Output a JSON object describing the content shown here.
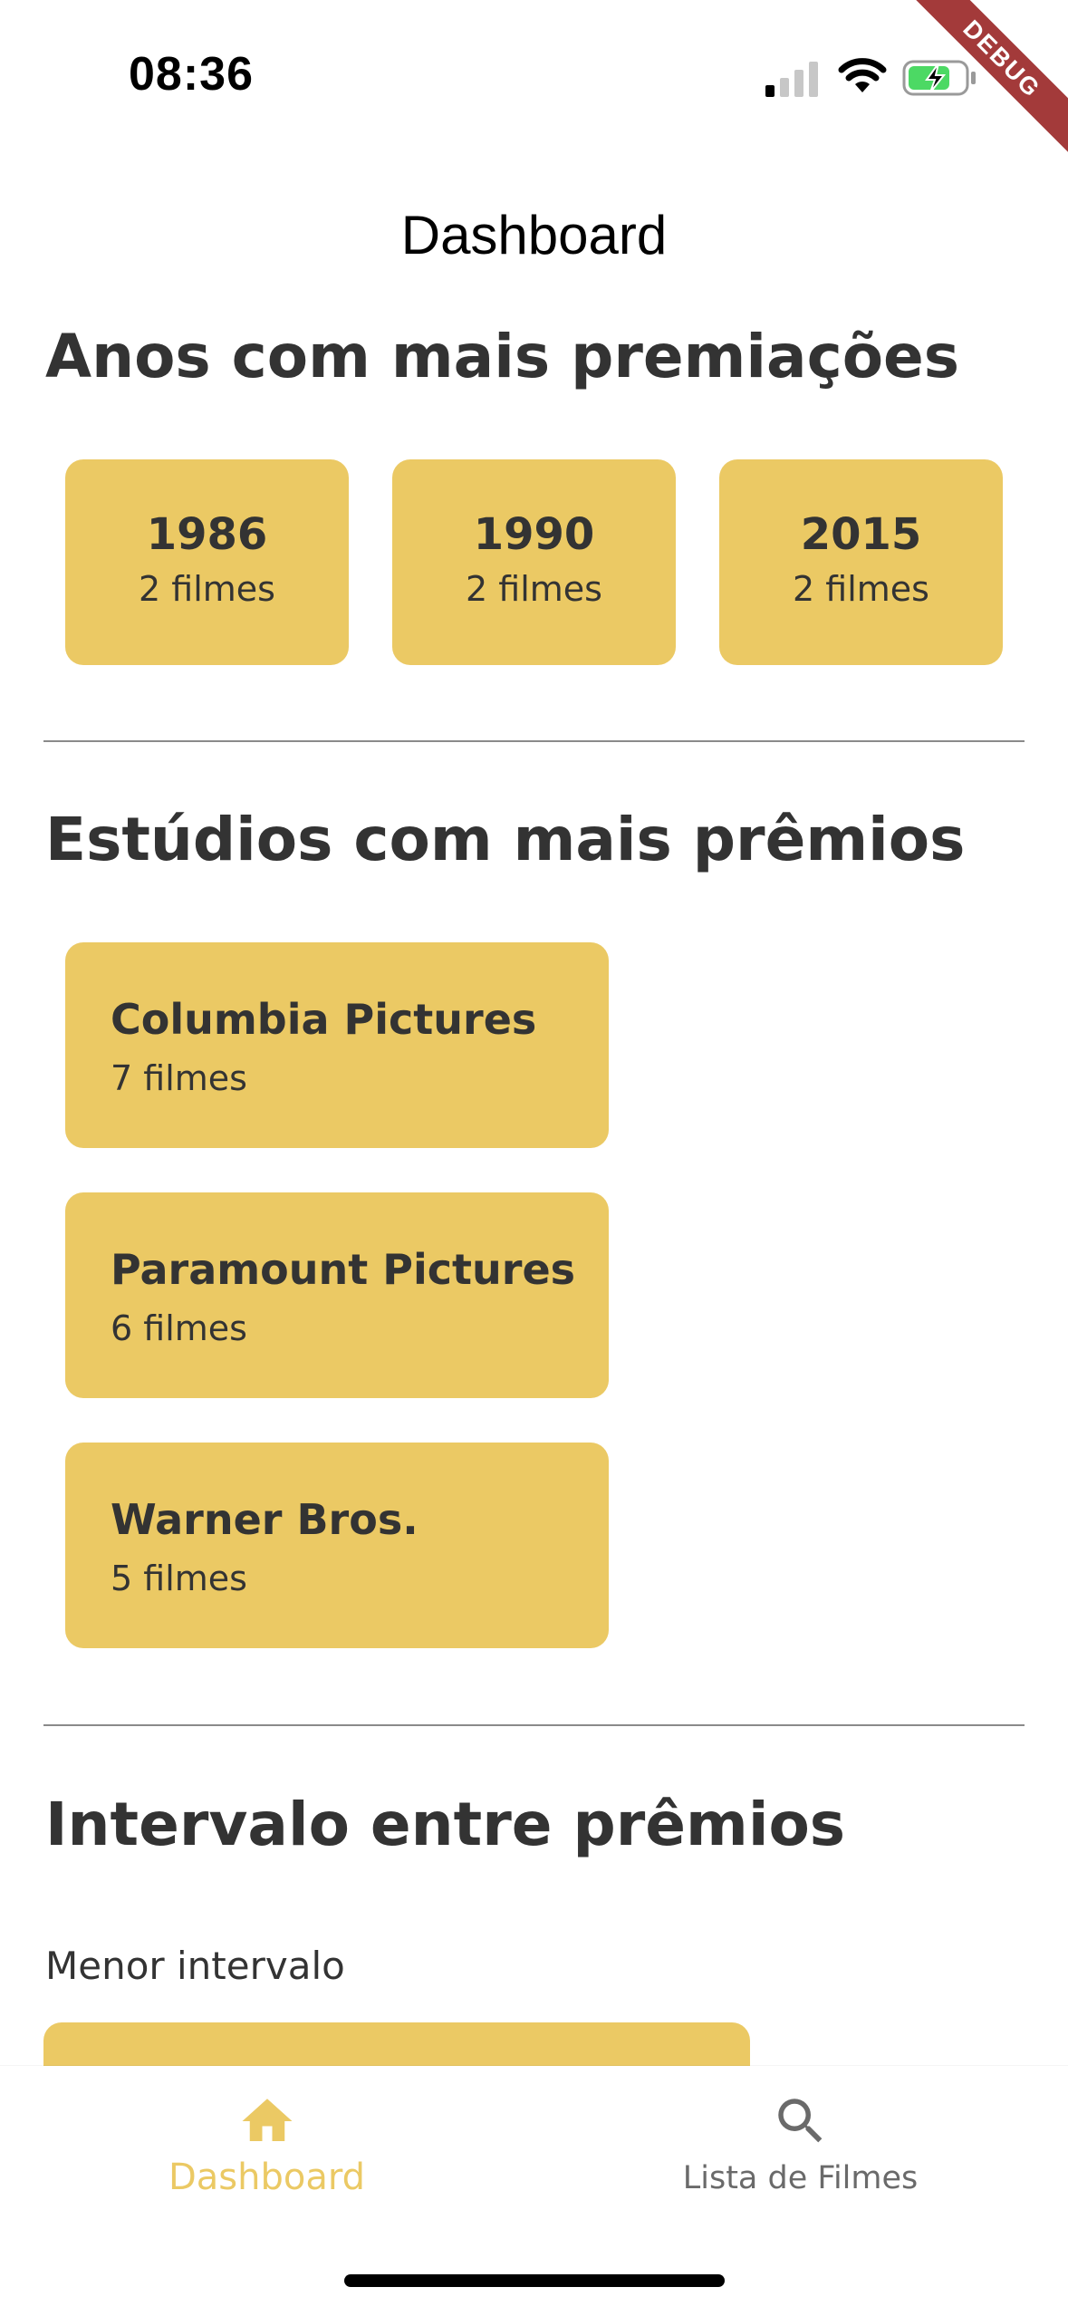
{
  "status_bar": {
    "time": "08:36",
    "signal_icon": "cellular-signal-icon",
    "wifi_icon": "wifi-icon",
    "battery_icon": "battery-charging-icon",
    "debug_banner": "DEBUG"
  },
  "app_bar": {
    "title": "Dashboard"
  },
  "years_section": {
    "title": "Anos com mais premiações",
    "items": [
      {
        "year": "1986",
        "count": "2 filmes"
      },
      {
        "year": "1990",
        "count": "2 filmes"
      },
      {
        "year": "2015",
        "count": "2 filmes"
      }
    ]
  },
  "studios_section": {
    "title": "Estúdios com mais prêmios",
    "items": [
      {
        "name": "Columbia Pictures",
        "count": "7 filmes"
      },
      {
        "name": "Paramount Pictures",
        "count": "6 filmes"
      },
      {
        "name": "Warner Bros.",
        "count": "5 filmes"
      }
    ]
  },
  "interval_section": {
    "title": "Intervalo entre prêmios",
    "subtitle": "Menor intervalo"
  },
  "bottom_nav": {
    "items": [
      {
        "label": "Dashboard",
        "icon": "home-icon",
        "active": true
      },
      {
        "label": "Lista de Filmes",
        "icon": "search-icon",
        "active": false
      }
    ]
  },
  "colors": {
    "accent": "#ebc964",
    "text": "#333333",
    "inactive": "#6a6a6a",
    "debug": "#a33a3a"
  }
}
